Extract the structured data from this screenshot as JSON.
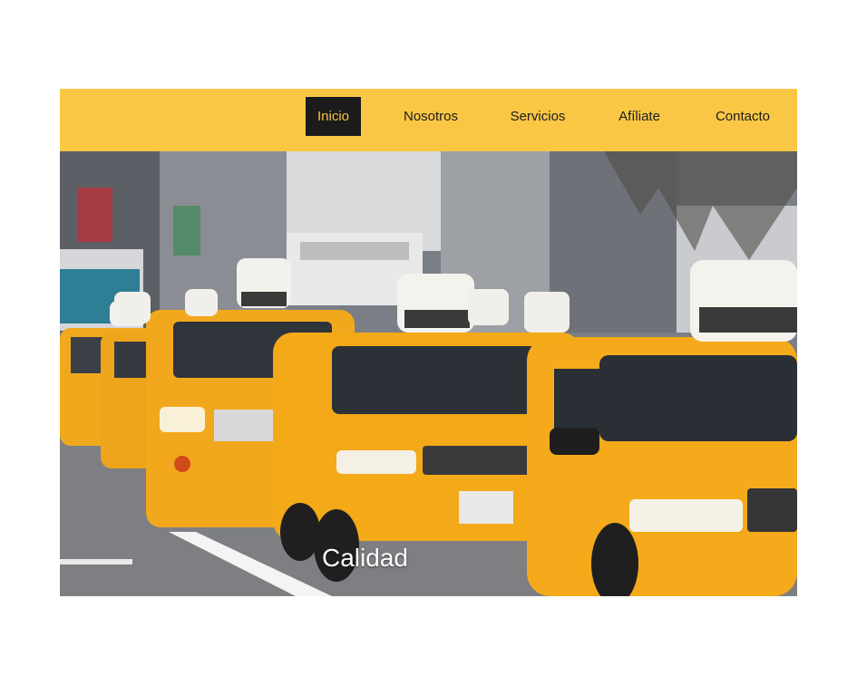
{
  "nav": {
    "items": [
      {
        "label": "Inicio",
        "active": true
      },
      {
        "label": "Nosotros",
        "active": false
      },
      {
        "label": "Servicios",
        "active": false
      },
      {
        "label": "Afíliate",
        "active": false
      },
      {
        "label": "Contacto",
        "active": false
      }
    ]
  },
  "hero": {
    "caption": "Calidad",
    "image": "yellow-taxi-cabs-street-photo"
  },
  "colors": {
    "nav_background": "#f9c744",
    "nav_active_background": "#1b1b1b",
    "nav_active_text": "#f6c444",
    "nav_text": "#1d1d1d",
    "taxi_yellow": "#f2a81c"
  }
}
